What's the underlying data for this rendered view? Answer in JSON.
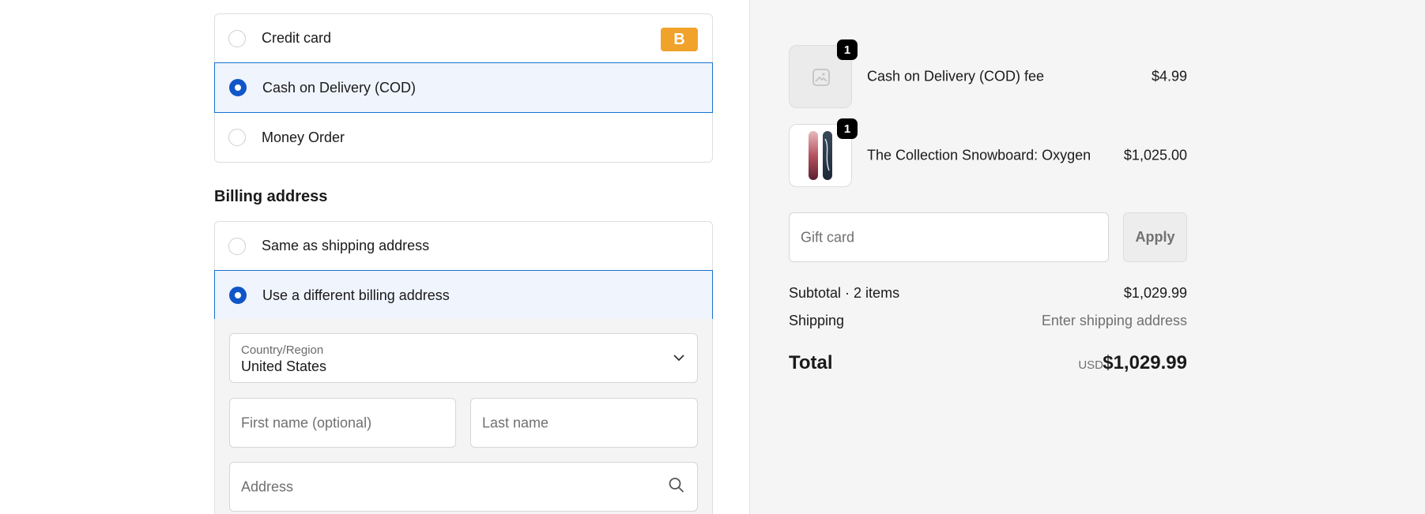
{
  "payment": {
    "options": [
      {
        "label": "Credit card",
        "selected": false,
        "badge": "B"
      },
      {
        "label": "Cash on Delivery (COD)",
        "selected": true
      },
      {
        "label": "Money Order",
        "selected": false
      }
    ]
  },
  "billing": {
    "title": "Billing address",
    "options": [
      {
        "label": "Same as shipping address",
        "selected": false
      },
      {
        "label": "Use a different billing address",
        "selected": true
      }
    ],
    "country_label": "Country/Region",
    "country_value": "United States",
    "first_name_placeholder": "First name (optional)",
    "last_name_placeholder": "Last name",
    "address_placeholder": "Address"
  },
  "summary": {
    "items": [
      {
        "name": "Cash on Delivery (COD) fee",
        "price": "$4.99",
        "qty": "1",
        "image": "image-placeholder-icon"
      },
      {
        "name": "The Collection Snowboard: Oxygen",
        "price": "$1,025.00",
        "qty": "1",
        "image": "snowboard-image"
      }
    ],
    "gift_placeholder": "Gift card",
    "apply_label": "Apply",
    "subtotal_label": "Subtotal · 2 items",
    "subtotal_value": "$1,029.99",
    "shipping_label": "Shipping",
    "shipping_value": "Enter shipping address",
    "total_label": "Total",
    "currency": "USD",
    "total_value": "$1,029.99"
  },
  "colors": {
    "accent": "#1056c8",
    "selected_bg": "#f0f4fd",
    "badge": "#f0a22b"
  }
}
